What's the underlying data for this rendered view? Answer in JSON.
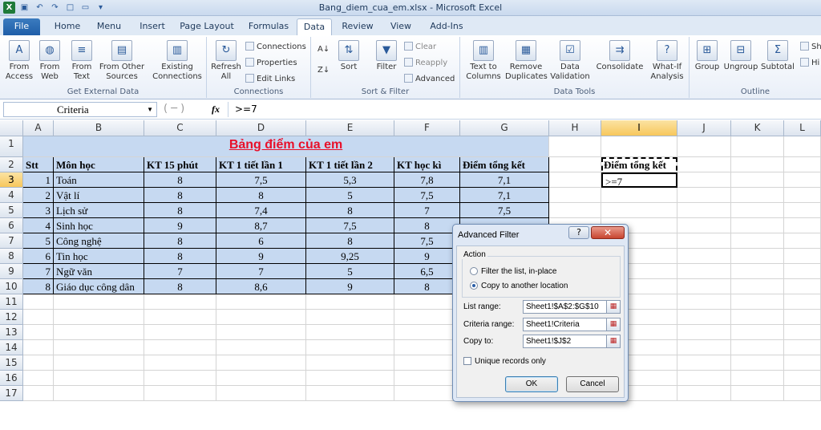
{
  "window": {
    "title": "Bang_diem_cua_em.xlsx - Microsoft Excel"
  },
  "tabs": [
    {
      "label": "File"
    },
    {
      "label": "Home"
    },
    {
      "label": "Menu"
    },
    {
      "label": "Insert"
    },
    {
      "label": "Page Layout"
    },
    {
      "label": "Formulas"
    },
    {
      "label": "Data"
    },
    {
      "label": "Review"
    },
    {
      "label": "View"
    },
    {
      "label": "Add-Ins"
    }
  ],
  "ribbon": {
    "get_external": {
      "label": "Get External Data",
      "access": "From\nAccess",
      "web": "From\nWeb",
      "text": "From\nText",
      "other": "From Other\nSources",
      "existing": "Existing\nConnections"
    },
    "connections": {
      "label": "Connections",
      "refresh": "Refresh\nAll",
      "conn": "Connections",
      "props": "Properties",
      "edit": "Edit Links"
    },
    "sort_filter": {
      "label": "Sort & Filter",
      "sort": "Sort",
      "filter": "Filter",
      "clear": "Clear",
      "reapply": "Reapply",
      "advanced": "Advanced"
    },
    "data_tools": {
      "label": "Data Tools",
      "t2c": "Text to\nColumns",
      "remove": "Remove\nDuplicates",
      "validation": "Data\nValidation",
      "consolidate": "Consolidate",
      "whatif": "What-If\nAnalysis"
    },
    "outline": {
      "label": "Outline",
      "group": "Group",
      "ungroup": "Ungroup",
      "subtotal": "Subtotal",
      "show": "Sh",
      "hide": "Hi"
    }
  },
  "formula_bar": {
    "name_box": "Criteria",
    "fx": "fx",
    "formula": ">=7"
  },
  "columns": [
    "A",
    "B",
    "C",
    "D",
    "E",
    "F",
    "G",
    "H",
    "I",
    "J",
    "K",
    "L"
  ],
  "rows": [
    "1",
    "2",
    "3",
    "4",
    "5",
    "6",
    "7",
    "8",
    "9",
    "10",
    "11",
    "12",
    "13",
    "14",
    "15",
    "16",
    "17"
  ],
  "sheet": {
    "title": "Bảng điểm của em",
    "headers": [
      "Stt",
      "Môn học",
      "KT 15 phút",
      "KT 1 tiết lần 1",
      "KT 1 tiết lần 2",
      "KT học kì",
      "Điểm tổng kết"
    ],
    "data": [
      [
        "1",
        "Toán",
        "8",
        "7,5",
        "5,3",
        "7,8",
        "7,1"
      ],
      [
        "2",
        "Vật lí",
        "8",
        "8",
        "5",
        "7,5",
        "7,1"
      ],
      [
        "3",
        "Lịch sử",
        "8",
        "7,4",
        "8",
        "7",
        "7,5"
      ],
      [
        "4",
        "Sinh học",
        "9",
        "8,7",
        "7,5",
        "8",
        ""
      ],
      [
        "5",
        "Công nghệ",
        "8",
        "6",
        "8",
        "7,5",
        ""
      ],
      [
        "6",
        "Tin học",
        "8",
        "9",
        "9,25",
        "9",
        ""
      ],
      [
        "7",
        "Ngữ văn",
        "7",
        "7",
        "5",
        "6,5",
        ""
      ],
      [
        "8",
        "Giáo dục công dân",
        "8",
        "8,6",
        "9",
        "8",
        ""
      ]
    ],
    "criteria_header": "Điểm tổng kết",
    "criteria_value": ">=7"
  },
  "dialog": {
    "title": "Advanced Filter",
    "help": "?",
    "close": "✕",
    "action_label": "Action",
    "opt_inplace": "Filter the list, in-place",
    "opt_copy": "Copy to another location",
    "list_range_label": "List range:",
    "list_range": "Sheet1!$A$2:$G$10",
    "criteria_label": "Criteria range:",
    "criteria_range": "Sheet1!Criteria",
    "copyto_label": "Copy to:",
    "copyto": "Sheet1!$J$2",
    "unique": "Unique records only",
    "ok": "OK",
    "cancel": "Cancel"
  }
}
